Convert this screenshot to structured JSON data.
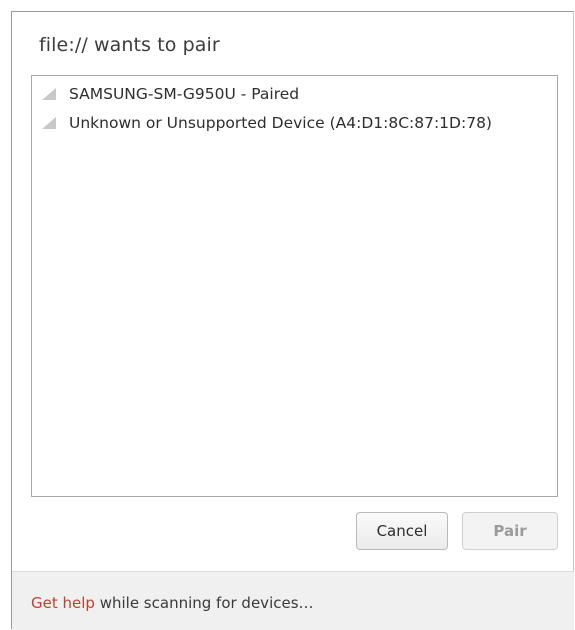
{
  "dialog": {
    "title": "file:// wants to pair"
  },
  "devices": [
    {
      "label": "SAMSUNG-SM-G950U - Paired",
      "icon": "signal-strength-icon"
    },
    {
      "label": "Unknown or Unsupported Device (A4:D1:8C:87:1D:78)",
      "icon": "signal-strength-icon"
    }
  ],
  "buttons": {
    "cancel_label": "Cancel",
    "pair_label": "Pair"
  },
  "footer": {
    "help_link": "Get help",
    "help_suffix": " while scanning for devices…"
  },
  "colors": {
    "link": "#c0412b",
    "signal_icon": "#c8c8c8"
  }
}
